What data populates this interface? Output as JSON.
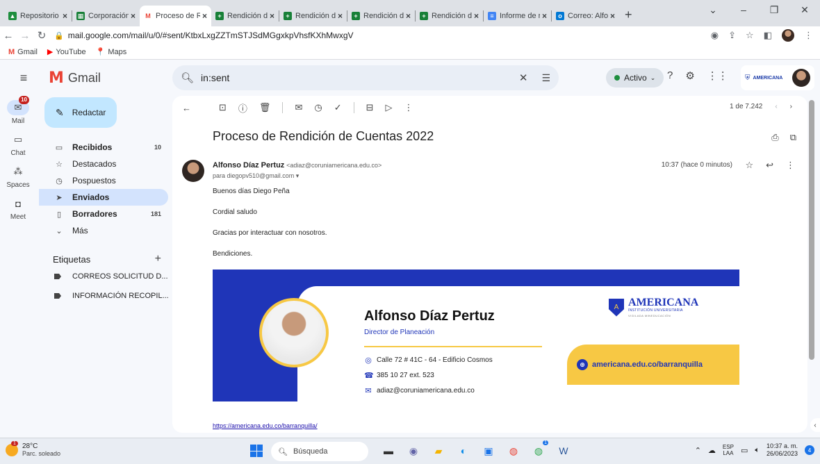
{
  "browser": {
    "tabs": [
      {
        "label": "Repositorio de",
        "color": "#1e8e3e"
      },
      {
        "label": "Corporación U",
        "color": "#188038"
      },
      {
        "label": "Proceso de Re",
        "color": "#ea4335",
        "active": true
      },
      {
        "label": "Rendición de",
        "color": "#188038"
      },
      {
        "label": "Rendición de",
        "color": "#188038"
      },
      {
        "label": "Rendición de",
        "color": "#188038"
      },
      {
        "label": "Rendición de",
        "color": "#188038"
      },
      {
        "label": "Informe de re",
        "color": "#4285f4"
      },
      {
        "label": "Correo: Alfon",
        "color": "#0078d4"
      }
    ],
    "url": "mail.google.com/mail/u/0/#sent/KtbxLxgZZTmSTJSdMGgxkpVhsfKXhMwxgV",
    "bookmarks": [
      "Gmail",
      "YouTube",
      "Maps"
    ]
  },
  "gmail": {
    "logo": "Gmail",
    "search_value": "in:sent",
    "status": "Activo",
    "org_name": "AMERICANA",
    "rail": [
      {
        "label": "Mail",
        "icon": "mail-icon",
        "badge": "10",
        "selected": true
      },
      {
        "label": "Chat",
        "icon": "chat-icon"
      },
      {
        "label": "Spaces",
        "icon": "spaces-icon"
      },
      {
        "label": "Meet",
        "icon": "meet-icon"
      }
    ],
    "compose": "Redactar",
    "folders": [
      {
        "label": "Recibidos",
        "count": "10",
        "bold": true
      },
      {
        "label": "Destacados",
        "count": ""
      },
      {
        "label": "Pospuestos",
        "count": ""
      },
      {
        "label": "Enviados",
        "count": "",
        "selected": true
      },
      {
        "label": "Borradores",
        "count": "181",
        "bold": true
      },
      {
        "label": "Más",
        "count": ""
      }
    ],
    "labels_title": "Etiquetas",
    "labels": [
      "CORREOS SOLICITUD D...",
      "INFORMACIÓN RECOPIL..."
    ]
  },
  "message": {
    "pager": "1 de 7.242",
    "subject": "Proceso de Rendición de Cuentas 2022",
    "sender_name": "Alfonso Díaz Pertuz",
    "sender_email": "<adiaz@coruniamericana.edu.co>",
    "to": "para diegopv510@gmail.com",
    "time": "10:37 (hace 0 minutos)",
    "body": [
      "Buenos días Diego Peña",
      "Cordial saludo",
      "Gracias por interactuar con nosotros.",
      "Bendiciones."
    ],
    "signature": {
      "name": "Alfonso Díaz Pertuz",
      "role": "Director de Planeación",
      "address": "Calle 72 # 41C - 64 - Edificio Cosmos",
      "phone": "385 10 27 ext. 523",
      "email": "adiaz@coruniamericana.edu.co",
      "brand": "AMERICANA",
      "brand_sub": "INSTITUCIÓN UNIVERSITARIA",
      "brand_motto": "VIGILADA MINEDUCACIÓN",
      "web": "americana.edu.co/barranquilla"
    },
    "footer_link": "https://americana.edu.co/barranquilla/"
  },
  "taskbar": {
    "temp": "28°C",
    "weather": "Parc. soleado",
    "search": "Búsqueda",
    "lang1": "ESP",
    "lang2": "LAA",
    "time": "10:37 a. m.",
    "date": "26/06/2023",
    "notif": "4"
  },
  "colors": {
    "brand_blue": "#1f35b8",
    "brand_yellow": "#f7c844",
    "selected": "#d3e3fd"
  }
}
